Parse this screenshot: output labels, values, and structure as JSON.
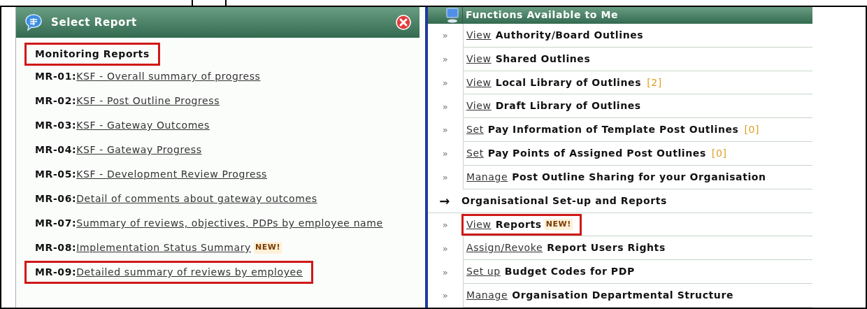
{
  "select_report": {
    "title": "Select Report",
    "section": {
      "label": "Monitoring Reports",
      "highlighted": true
    },
    "reports": [
      {
        "code": "MR-01:",
        "link": "KSF - Overall summary of progress",
        "highlighted": false
      },
      {
        "code": "MR-02:",
        "link": "KSF - Post Outline Progress",
        "highlighted": false
      },
      {
        "code": "MR-03:",
        "link": "KSF - Gateway Outcomes",
        "highlighted": false
      },
      {
        "code": "MR-04:",
        "link": "KSF - Gateway Progress",
        "highlighted": false
      },
      {
        "code": "MR-05:",
        "link": "KSF - Development Review Progress",
        "highlighted": false
      },
      {
        "code": "MR-06:",
        "link": "Detail of comments about gateway outcomes",
        "highlighted": false
      },
      {
        "code": "MR-07:",
        "link": "Summary of reviews, objectives, PDPs by employee name",
        "highlighted": false
      },
      {
        "code": "MR-08:",
        "link": "Implementation Status Summary",
        "new_badge": "NEW!",
        "highlighted": false
      },
      {
        "code": "MR-09:",
        "link": "Detailed summary of reviews by employee",
        "highlighted": true
      }
    ]
  },
  "functions": {
    "title": "Functions Available to Me",
    "items": [
      {
        "kind": "link",
        "bullet": "»",
        "action": "View",
        "subject": "Authority/Board Outlines",
        "highlighted": false
      },
      {
        "kind": "link",
        "bullet": "»",
        "action": "View",
        "subject": "Shared Outlines",
        "highlighted": false
      },
      {
        "kind": "link",
        "bullet": "»",
        "action": "View",
        "subject": "Local Library of Outlines",
        "count": "[2]",
        "highlighted": false
      },
      {
        "kind": "link",
        "bullet": "»",
        "action": "View",
        "subject": "Draft Library of Outlines",
        "highlighted": false
      },
      {
        "kind": "link",
        "bullet": "»",
        "action": "Set",
        "subject": "Pay Information of Template Post Outlines",
        "count": "[0]",
        "highlighted": false
      },
      {
        "kind": "link",
        "bullet": "»",
        "action": "Set",
        "subject": "Pay Points of Assigned Post Outlines",
        "count": "[0]",
        "highlighted": false
      },
      {
        "kind": "link",
        "bullet": "»",
        "action": "Manage",
        "subject": "Post Outline Sharing for your Organisation",
        "highlighted": false
      },
      {
        "kind": "section",
        "bullet": "→",
        "subject": "Organisational Set-up and Reports"
      },
      {
        "kind": "link",
        "bullet": "»",
        "action": "View",
        "subject": "Reports",
        "new_badge": "NEW!",
        "highlighted": true
      },
      {
        "kind": "link",
        "bullet": "»",
        "action": "Assign/Revoke",
        "subject": "Report Users Rights",
        "highlighted": false
      },
      {
        "kind": "link",
        "bullet": "»",
        "action": "Set up",
        "subject": "Budget Codes for PDP",
        "highlighted": false
      },
      {
        "kind": "link",
        "bullet": "»",
        "action": "Manage",
        "subject": "Organisation Departmental Structure",
        "highlighted": false
      }
    ]
  }
}
